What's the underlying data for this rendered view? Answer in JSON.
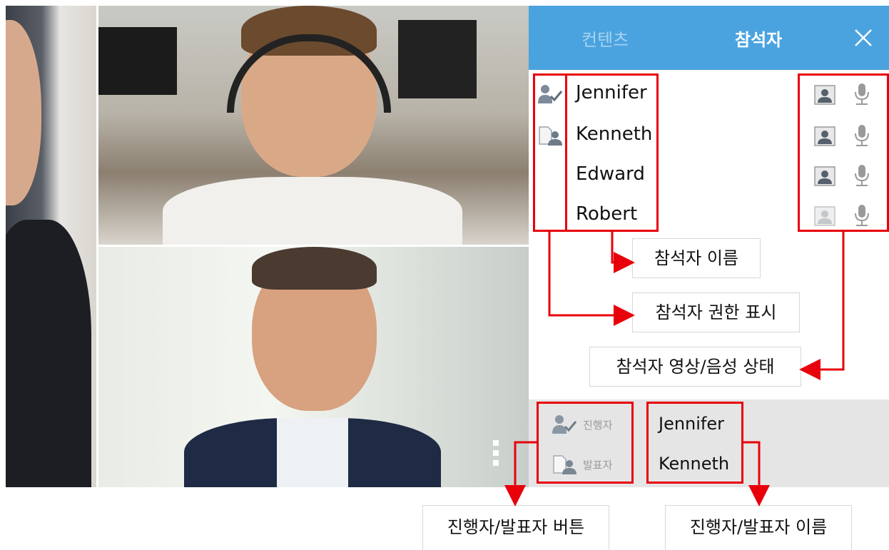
{
  "panel": {
    "tabs": [
      {
        "label": "컨텐츠"
      },
      {
        "label": "참석자"
      }
    ],
    "close_icon": "close-icon",
    "participants": [
      {
        "name": "Jennifer",
        "role_icon": "host-check-icon",
        "camera": "on",
        "mic": "on"
      },
      {
        "name": "Kenneth",
        "role_icon": "presenter-icon",
        "camera": "on",
        "mic": "on"
      },
      {
        "name": "Edward",
        "role_icon": "",
        "camera": "on",
        "mic": "on"
      },
      {
        "name": "Robert",
        "role_icon": "",
        "camera": "off",
        "mic": "on"
      }
    ],
    "strip": {
      "host_label": "진행자",
      "presenter_label": "발표자",
      "host_name": "Jennifer",
      "presenter_name": "Kenneth"
    }
  },
  "callouts": {
    "name": "참석자 이름",
    "role": "참석자 권한 표시",
    "av_status": "참석자 영상/음성 상태",
    "strip_buttons": "진행자/발표자 버튼",
    "strip_names": "진행자/발표자 이름"
  },
  "colors": {
    "header": "#4aa3df",
    "annotation_red": "#e8000b",
    "strip_bg": "#e5e5e5"
  }
}
